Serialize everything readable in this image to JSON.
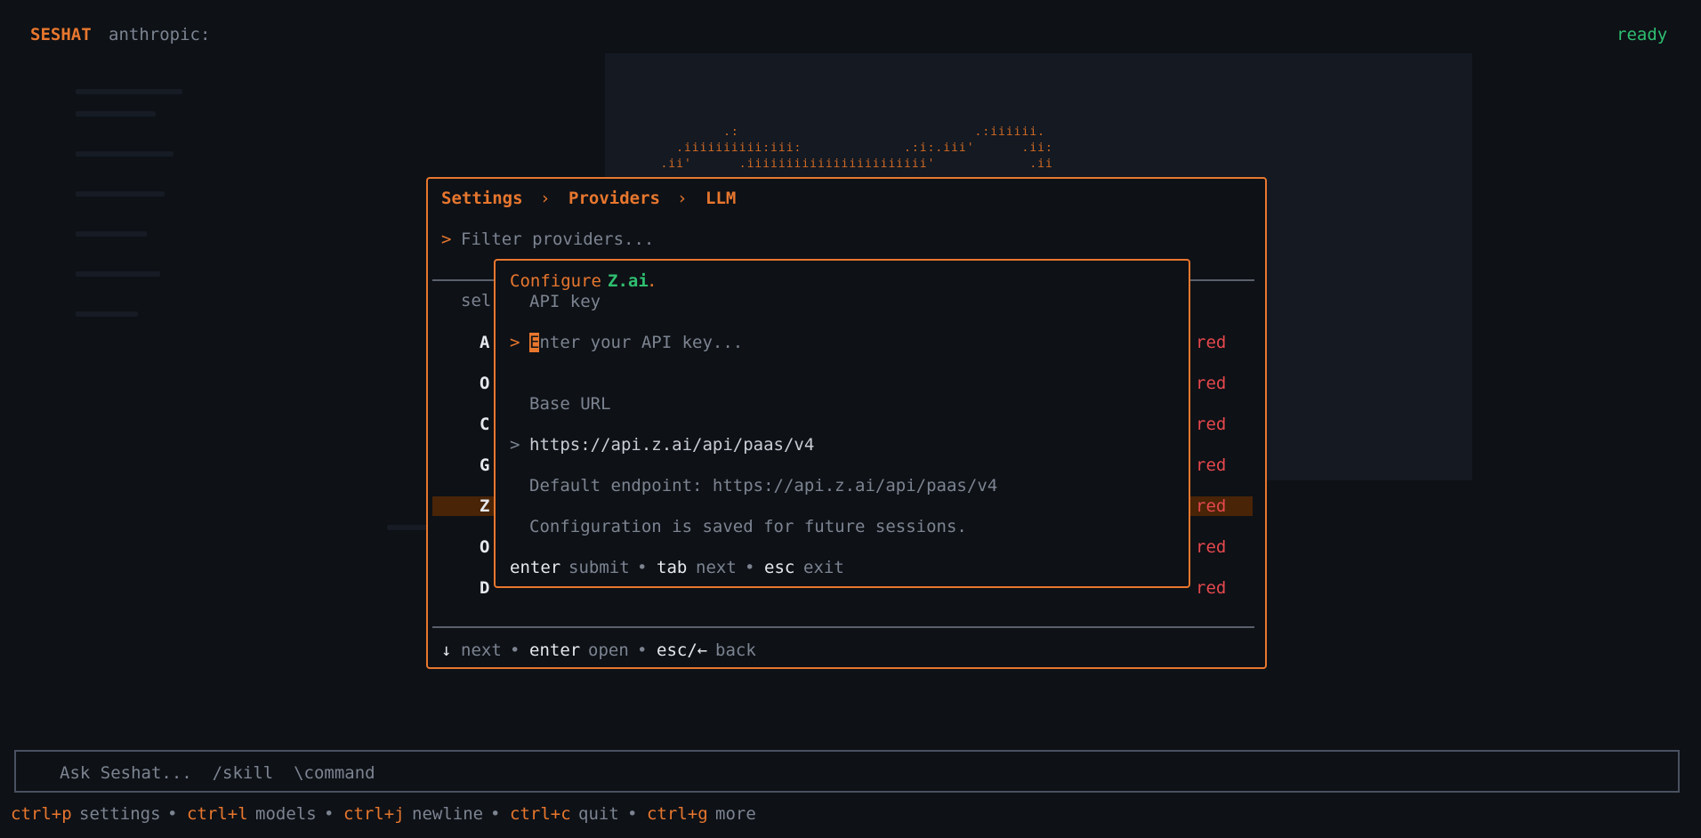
{
  "app": {
    "name": "SESHAT",
    "provider": "anthropic:",
    "status": "ready"
  },
  "ascii_art": [
    "           .:                              .:iiiiii.",
    "     .iiiiiiiiii:iii:             .:i:.iii'      .ii:",
    "   .ii'      .iiiiiiiiiiiiiiiiiiiiiii'            .ii"
  ],
  "settings": {
    "breadcrumb": [
      "Settings",
      "Providers",
      "LLM"
    ],
    "separator": "›",
    "filter_prompt": ">",
    "filter_placeholder": "Filter providers...",
    "list_header": "sel",
    "providers": [
      {
        "initial": "A",
        "status": "red",
        "selected": false
      },
      {
        "initial": "O",
        "status": "red",
        "selected": false
      },
      {
        "initial": "C",
        "status": "red",
        "selected": false
      },
      {
        "initial": "G",
        "status": "red",
        "selected": false
      },
      {
        "initial": "Z",
        "status": "red",
        "selected": true
      },
      {
        "initial": "O",
        "status": "red",
        "selected": false
      },
      {
        "initial": "D",
        "status": "red",
        "selected": false
      }
    ],
    "footer": [
      {
        "key": "↓",
        "action": "next"
      },
      {
        "key": "enter",
        "action": "open"
      },
      {
        "key": "esc/←",
        "action": "back"
      }
    ]
  },
  "dialog": {
    "title_prefix": "Configure ",
    "provider_name": "Z.ai",
    "title_suffix": ".",
    "api_key_label": "API key",
    "prompt": ">",
    "api_key_cursor_char": "E",
    "api_key_placeholder": "nter your API key...",
    "base_url_label": "Base URL",
    "base_url_value": "https://api.z.ai/api/paas/v4",
    "default_endpoint": "Default endpoint: https://api.z.ai/api/paas/v4",
    "saved_note": "Configuration is saved for future sessions.",
    "hints": [
      {
        "key": "enter",
        "action": "submit"
      },
      {
        "key": "tab",
        "action": "next"
      },
      {
        "key": "esc",
        "action": "exit"
      }
    ],
    "bullet": "•"
  },
  "input": {
    "placeholder": "Ask Seshat...  /skill  \\command"
  },
  "shortcuts": [
    {
      "key": "ctrl+p",
      "action": "settings"
    },
    {
      "key": "ctrl+l",
      "action": "models"
    },
    {
      "key": "ctrl+j",
      "action": "newline"
    },
    {
      "key": "ctrl+c",
      "action": "quit"
    },
    {
      "key": "ctrl+g",
      "action": "more"
    }
  ],
  "colors": {
    "accent": "#e8772e",
    "background": "#0e1116",
    "status_ready": "#2fbf71",
    "status_red": "#e5484d",
    "selected_row": "#4a2407"
  }
}
